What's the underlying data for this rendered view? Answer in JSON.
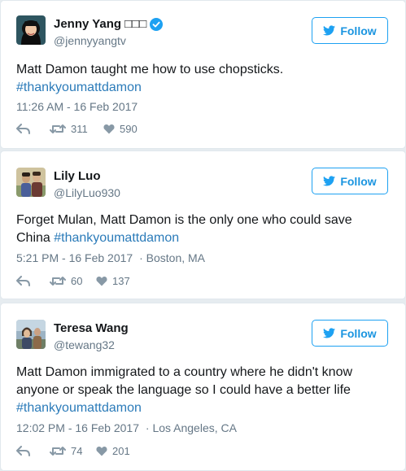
{
  "follow_label": "Follow",
  "colors": {
    "accent": "#1da1f2",
    "link": "#2b7bb9",
    "muted": "#657786"
  },
  "tweets": [
    {
      "name": "Jenny Yang",
      "name_suffix": "□□□",
      "verified": true,
      "handle": "@jennyyangtv",
      "text": "Matt Damon taught me how to use chopsticks.",
      "hashtag": "#thankyoumattdamon",
      "time": "11:26 AM - 16 Feb 2017",
      "location": "",
      "retweets": "311",
      "likes": "590"
    },
    {
      "name": "Lily Luo",
      "name_suffix": "",
      "verified": false,
      "handle": "@LilyLuo930",
      "text": "Forget Mulan, Matt Damon is the only one who could save China",
      "hashtag": "#thankyoumattdamon",
      "time": "5:21 PM - 16 Feb 2017",
      "location": "· Boston, MA",
      "retweets": "60",
      "likes": "137"
    },
    {
      "name": "Teresa Wang",
      "name_suffix": "",
      "verified": false,
      "handle": "@tewang32",
      "text_line1": "Matt Damon immigrated to a country where he didn't know",
      "text_line2": "anyone or speak the language so I could have a better life",
      "hashtag": "#thankyoumattdamon",
      "time": "12:02 PM - 16 Feb 2017",
      "location": "· Los Angeles, CA",
      "retweets": "74",
      "likes": "201"
    }
  ]
}
